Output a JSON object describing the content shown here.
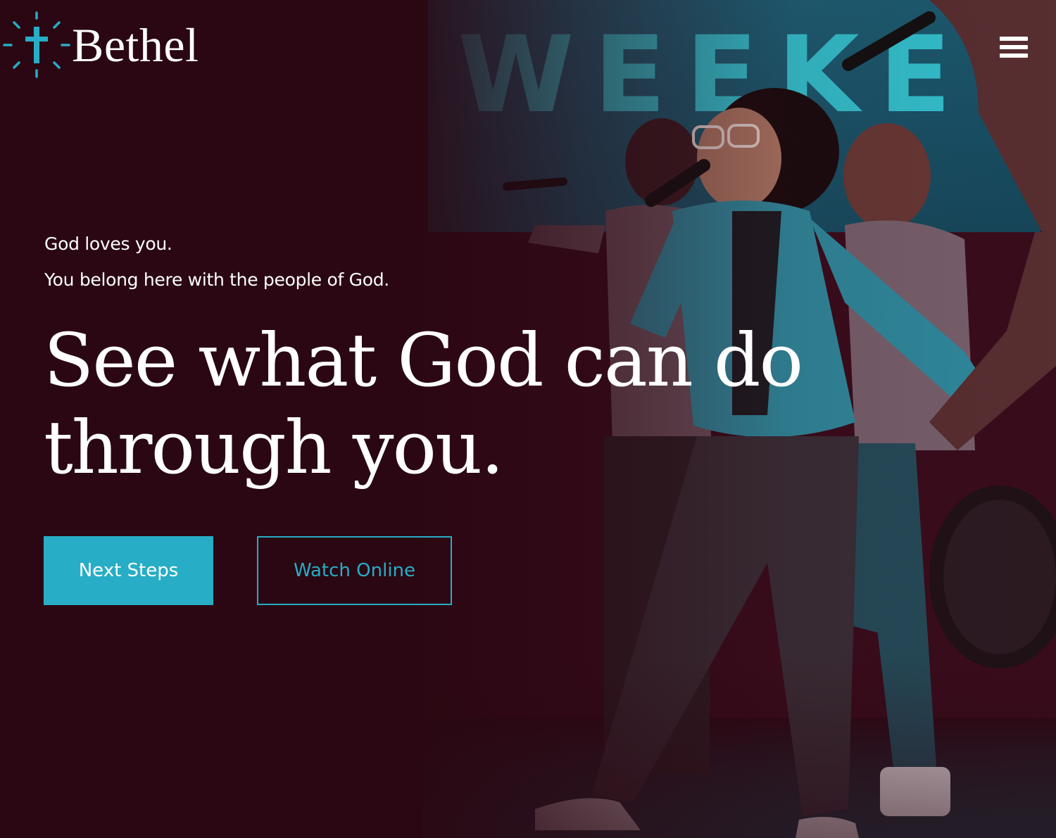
{
  "brand": {
    "name": "Bethel",
    "logo_icon": "cross-burst-icon",
    "accent_color": "#27adc6",
    "background_color": "#2a0712"
  },
  "header": {
    "menu_icon": "hamburger-menu-icon"
  },
  "hero": {
    "photo_description_icon": "worship-team-stage-photo",
    "stage_screen_text": "WEEKEN",
    "tagline_1": "God loves you.",
    "tagline_2": "You belong here with the people of God.",
    "headline": "See what God can do through you.",
    "primary_cta": "Next Steps",
    "secondary_cta": "Watch Online"
  }
}
